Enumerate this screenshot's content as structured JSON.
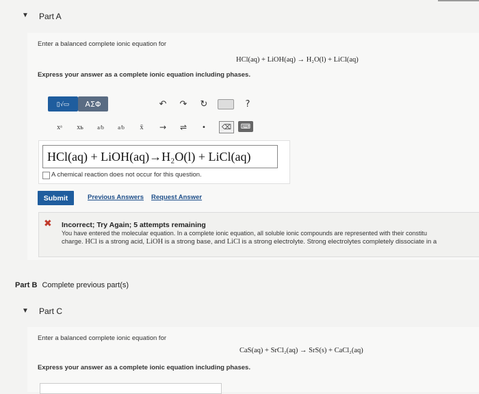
{
  "partA": {
    "title": "Part A",
    "prompt": "Enter a balanced complete ionic equation for",
    "equation": "HCl(aq) + LiOH(aq) → H₂O(l) + LiCl(aq)",
    "instruction": "Express your answer as a complete ionic equation including phases.",
    "toolbar": {
      "templates_label": "▯√▭",
      "greek_label": "ΑΣΦ",
      "undo_icon": "undo-icon",
      "redo_icon": "redo-icon",
      "reset_icon": "reset-icon",
      "keyboard_icon": "keyboard-icon",
      "help_label": "?",
      "superscript_label": "xᵃ",
      "subscript_label": "xь",
      "fraction_label": "a/b",
      "fraction2_label": "a/b",
      "overline_label": "x̄",
      "arrow_label": "→",
      "equilibrium_label": "⇌",
      "dot_label": "•",
      "delete_label": "⌫",
      "keyboard2_label": "⌨"
    },
    "answer": "HCl(aq) + LiOH(aq)→H₂O(l) + LiCl(aq)",
    "no_reaction_label": "A chemical reaction does not occur for this question.",
    "submit_label": "Submit",
    "previous_answers_label": "Previous Answers",
    "request_answer_label": "Request Answer",
    "feedback": {
      "title": "Incorrect; Try Again; 5 attempts remaining",
      "line1": "You have entered the molecular equation. In a complete ionic equation, all soluble ionic compounds are represented with their constitu",
      "line2_pre": "charge. ",
      "hcl": "HCl",
      "line2_a": " is a strong acid, ",
      "lioh": "LiOH",
      "line2_b": " is a strong base, and ",
      "licl": "LiCl",
      "line2_c": " is a strong electrolyte. Strong electrolytes completely dissociate in a"
    }
  },
  "partB": {
    "label": "Part B",
    "text": "Complete previous part(s)"
  },
  "partC": {
    "title": "Part C",
    "prompt": "Enter a balanced complete ionic equation for",
    "equation": "CaS(aq) + SrCl₂(aq) → SrS(s) + CaCl₂(aq)",
    "instruction": "Express your answer as a complete ionic equation including phases."
  }
}
